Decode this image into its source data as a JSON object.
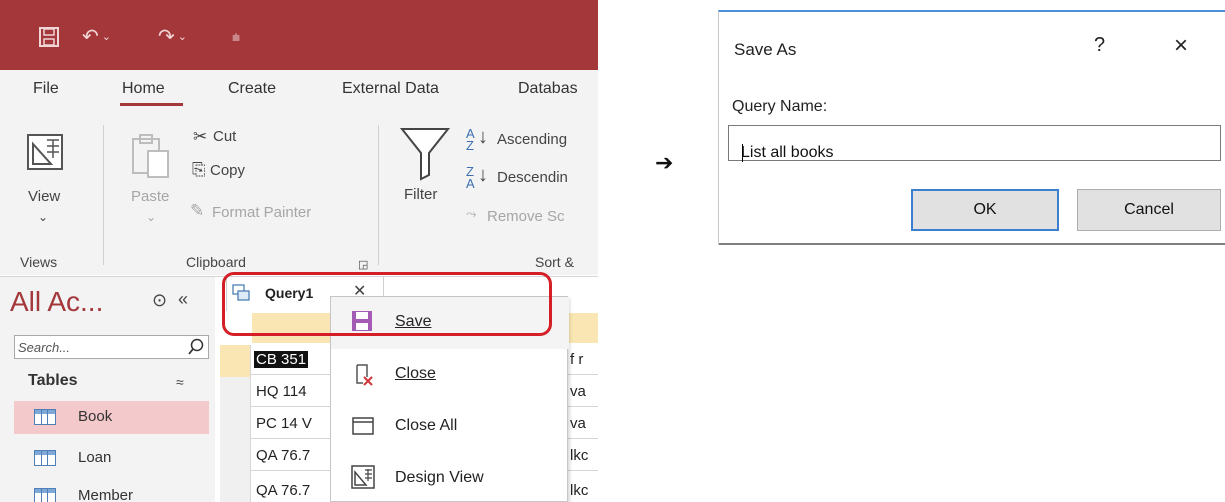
{
  "access": {
    "ribbon_tabs": [
      "File",
      "Home",
      "Create",
      "External Data",
      "Databas"
    ],
    "views_group": {
      "view_label": "View",
      "group_label": "Views"
    },
    "clipboard_group": {
      "paste_label": "Paste",
      "cut_label": "Cut",
      "copy_label": "Copy",
      "format_painter_label": "Format Painter",
      "group_label": "Clipboard"
    },
    "sort_group": {
      "filter_label": "Filter",
      "ascending_label": "Ascending",
      "descending_label": "Descendin",
      "remove_sort_label": "Remove Sc",
      "group_label": "Sort &"
    },
    "nav_pane": {
      "title": "All Ac...",
      "search_placeholder": "Search...",
      "group_label": "Tables",
      "items": [
        {
          "label": "Book",
          "selected": true
        },
        {
          "label": "Loan",
          "selected": false
        },
        {
          "label": "Member",
          "selected": false
        }
      ]
    },
    "document_tab": {
      "label": "Query1"
    },
    "datasheet": {
      "rows": [
        {
          "c1": "CB 351",
          "c2": "f r"
        },
        {
          "c1": "HQ 114",
          "c2": "va"
        },
        {
          "c1": "PC 14 V",
          "c2": "va"
        },
        {
          "c1": "QA 76.7",
          "c2": "lkc"
        },
        {
          "c1": "QA 76.7",
          "c2": "lkc"
        }
      ]
    },
    "context_menu": {
      "items": [
        {
          "label": "Save",
          "icon": "save-icon"
        },
        {
          "label": "Close",
          "icon": "close-doc-icon"
        },
        {
          "label": "Close All",
          "icon": "close-all-icon"
        },
        {
          "label": "Design View",
          "icon": "design-view-icon"
        }
      ]
    },
    "colors": {
      "access_accent": "#a4373a",
      "highlight": "#d41f27"
    }
  },
  "arrow": "➔",
  "dialog": {
    "title": "Save As",
    "help": "?",
    "close": "×",
    "field_label": "Query Name:",
    "field_value": "List all books",
    "ok_label": "OK",
    "cancel_label": "Cancel"
  }
}
